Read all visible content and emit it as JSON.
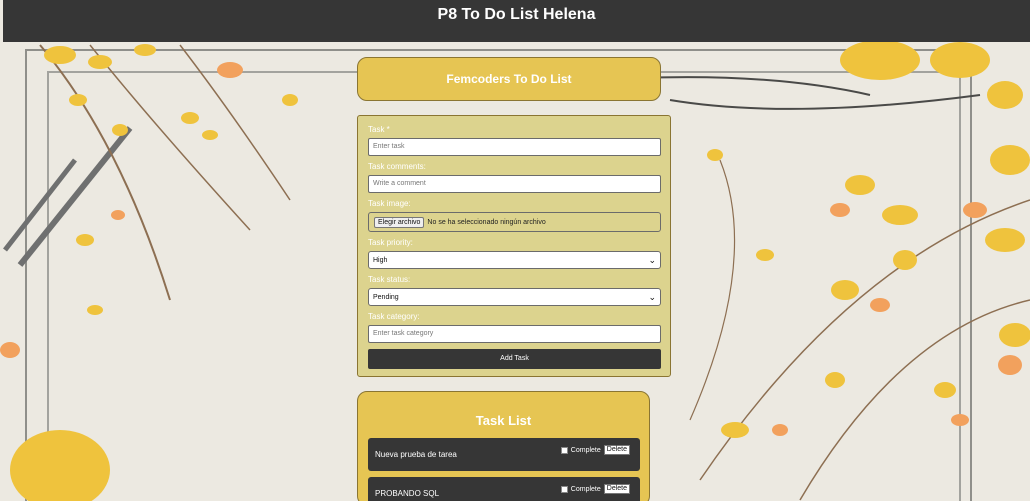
{
  "app": {
    "title": "P8 To Do List Helena"
  },
  "header_card": {
    "title": "Femcoders To Do List"
  },
  "form": {
    "task_label": "Task *",
    "task_placeholder": "Enter task",
    "comments_label": "Task comments:",
    "comments_placeholder": "Write a comment",
    "image_label": "Task image:",
    "file_button": "Elegir archivo",
    "file_status": "No se ha seleccionado ningún archivo",
    "priority_label": "Task priority:",
    "priority_value": "High",
    "status_label": "Task status:",
    "status_value": "Pending",
    "category_label": "Task category:",
    "category_placeholder": "Enter task category",
    "submit_label": "Add Task"
  },
  "task_list": {
    "title": "Task List",
    "complete_label": "Complete",
    "delete_label": "Delete",
    "items": [
      {
        "name": "Nueva prueba de tarea"
      },
      {
        "name": "PROBANDO SQL"
      }
    ]
  },
  "colors": {
    "topbar": "#363636",
    "card_yellow": "#e6c553",
    "form_bg": "#dcd38e",
    "task_bg": "#363636"
  },
  "icons": {
    "dropdown": "chevron-down-icon"
  }
}
